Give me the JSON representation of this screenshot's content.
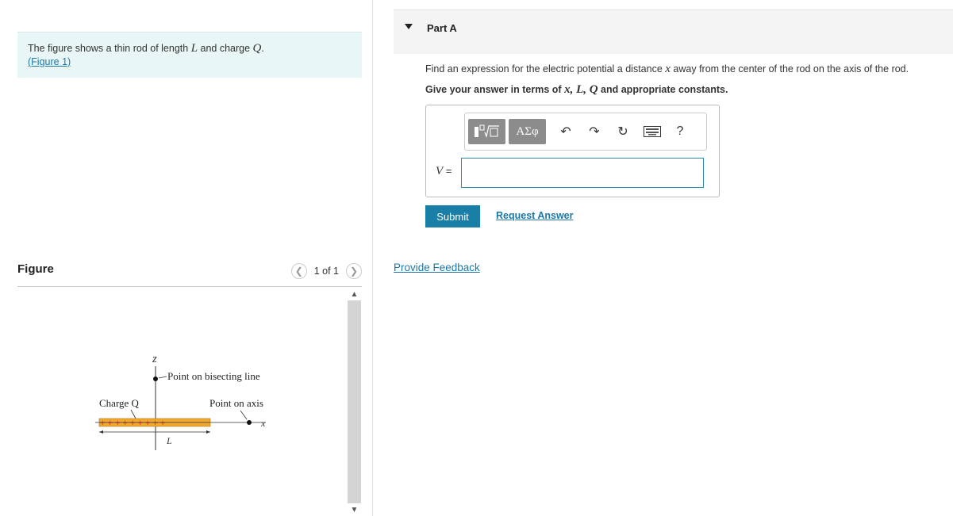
{
  "intro": {
    "text_prefix": "The figure shows a thin rod of length ",
    "var_L": "L",
    "text_mid": " and charge ",
    "var_Q": "Q",
    "text_end": ".",
    "figure_link": "(Figure 1)"
  },
  "figure_panel": {
    "title": "Figure",
    "pager_text": "1 of 1",
    "prev_icon": "chevron-left-icon",
    "next_icon": "chevron-right-icon"
  },
  "figure": {
    "z_label": "z",
    "bisect_label": "Point on bisecting line",
    "charge_label": "Charge Q",
    "axis_point_label": "Point on axis",
    "x_label": "x",
    "length_label": "L",
    "plus_signs": "+ + + + + + + + +",
    "rod_color": "#f0a830",
    "plus_color": "#e0301e"
  },
  "part": {
    "title": "Part A",
    "question_prefix": "Find an expression for the electric potential a distance ",
    "question_var": "x",
    "question_suffix": " away from the center of the rod on the axis of the rod.",
    "instruction_prefix": "Give your answer in terms of ",
    "instruction_vars": "x, L, Q",
    "instruction_suffix": " and appropriate constants."
  },
  "answer": {
    "toolbar": {
      "templates_icon": "templates-icon",
      "greek_label": "ΑΣφ",
      "undo_icon": "undo-icon",
      "redo_icon": "redo-icon",
      "reset_icon": "reset-icon",
      "keyboard_icon": "keyboard-icon",
      "help_label": "?"
    },
    "variable_label": "V",
    "equals": " =",
    "input_value": ""
  },
  "actions": {
    "submit_label": "Submit",
    "request_label": "Request Answer",
    "feedback_label": "Provide Feedback"
  },
  "colors": {
    "accent": "#1a7fa6",
    "link": "#1b78a6",
    "intro_bg": "#e8f6f6"
  }
}
